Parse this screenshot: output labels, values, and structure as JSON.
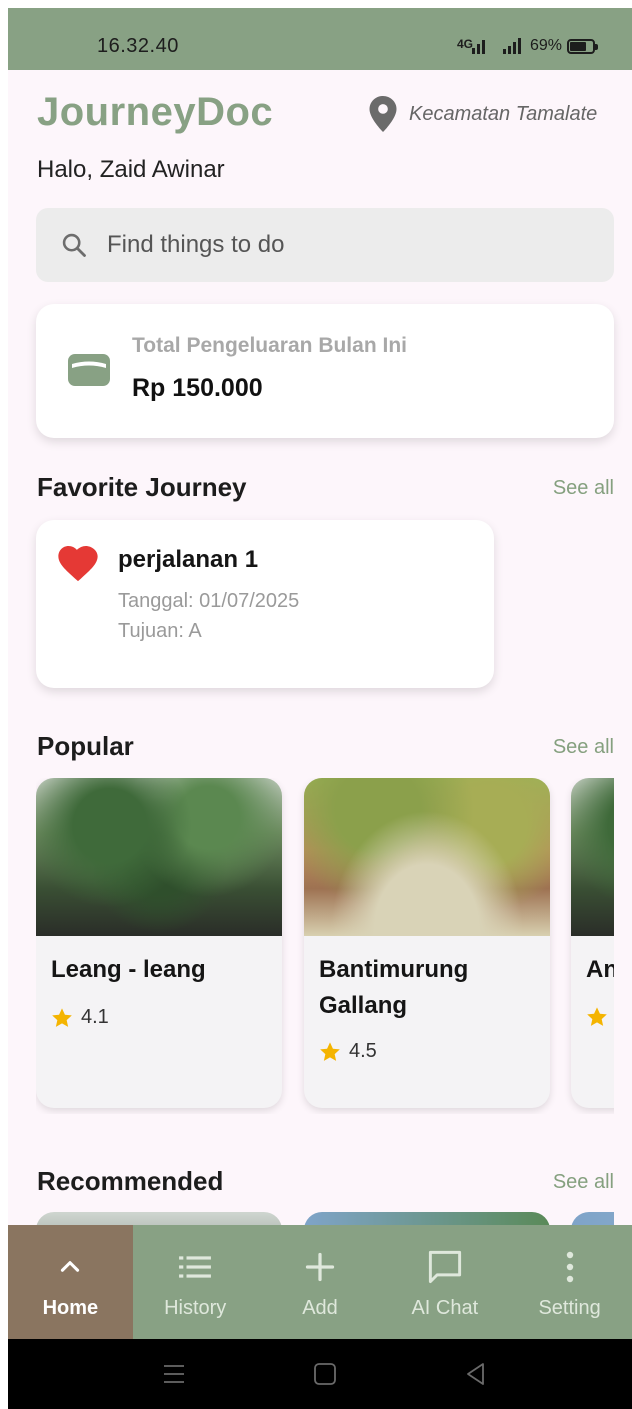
{
  "status_bar": {
    "time": "16.32.40",
    "network": "4G",
    "battery": "69%"
  },
  "header": {
    "app_title": "JourneyDoc",
    "location": "Kecamatan Tamalate",
    "greeting": "Halo, Zaid Awinar"
  },
  "search": {
    "placeholder": "Find things to do"
  },
  "expense": {
    "label": "Total Pengeluaran Bulan Ini",
    "amount": "Rp 150.000"
  },
  "favorite": {
    "title": "Favorite Journey",
    "see_all": "See all",
    "items": [
      {
        "name": "perjalanan 1",
        "date": "Tanggal: 01/07/2025",
        "destination": "Tujuan: A"
      }
    ]
  },
  "popular": {
    "title": "Popular",
    "see_all": "See all",
    "items": [
      {
        "name": "Leang - leang",
        "rating": "4.1"
      },
      {
        "name": "Bantimurung Gallang",
        "rating": "4.5"
      },
      {
        "name": "An",
        "rating": ""
      }
    ]
  },
  "recommended": {
    "title": "Recommended",
    "see_all": "See all"
  },
  "bottom_nav": {
    "items": [
      {
        "label": "Home",
        "icon": "chevron-up-icon",
        "active": true
      },
      {
        "label": "History",
        "icon": "list-icon",
        "active": false
      },
      {
        "label": "Add",
        "icon": "plus-icon",
        "active": false
      },
      {
        "label": "AI Chat",
        "icon": "chat-bubble-icon",
        "active": false
      },
      {
        "label": "Setting",
        "icon": "more-vertical-icon",
        "active": false
      }
    ]
  },
  "colors": {
    "accent": "#88a184",
    "nav_active": "#8a7560",
    "heart": "#e53935",
    "star": "#f4b400",
    "background": "#fdf6fb"
  }
}
